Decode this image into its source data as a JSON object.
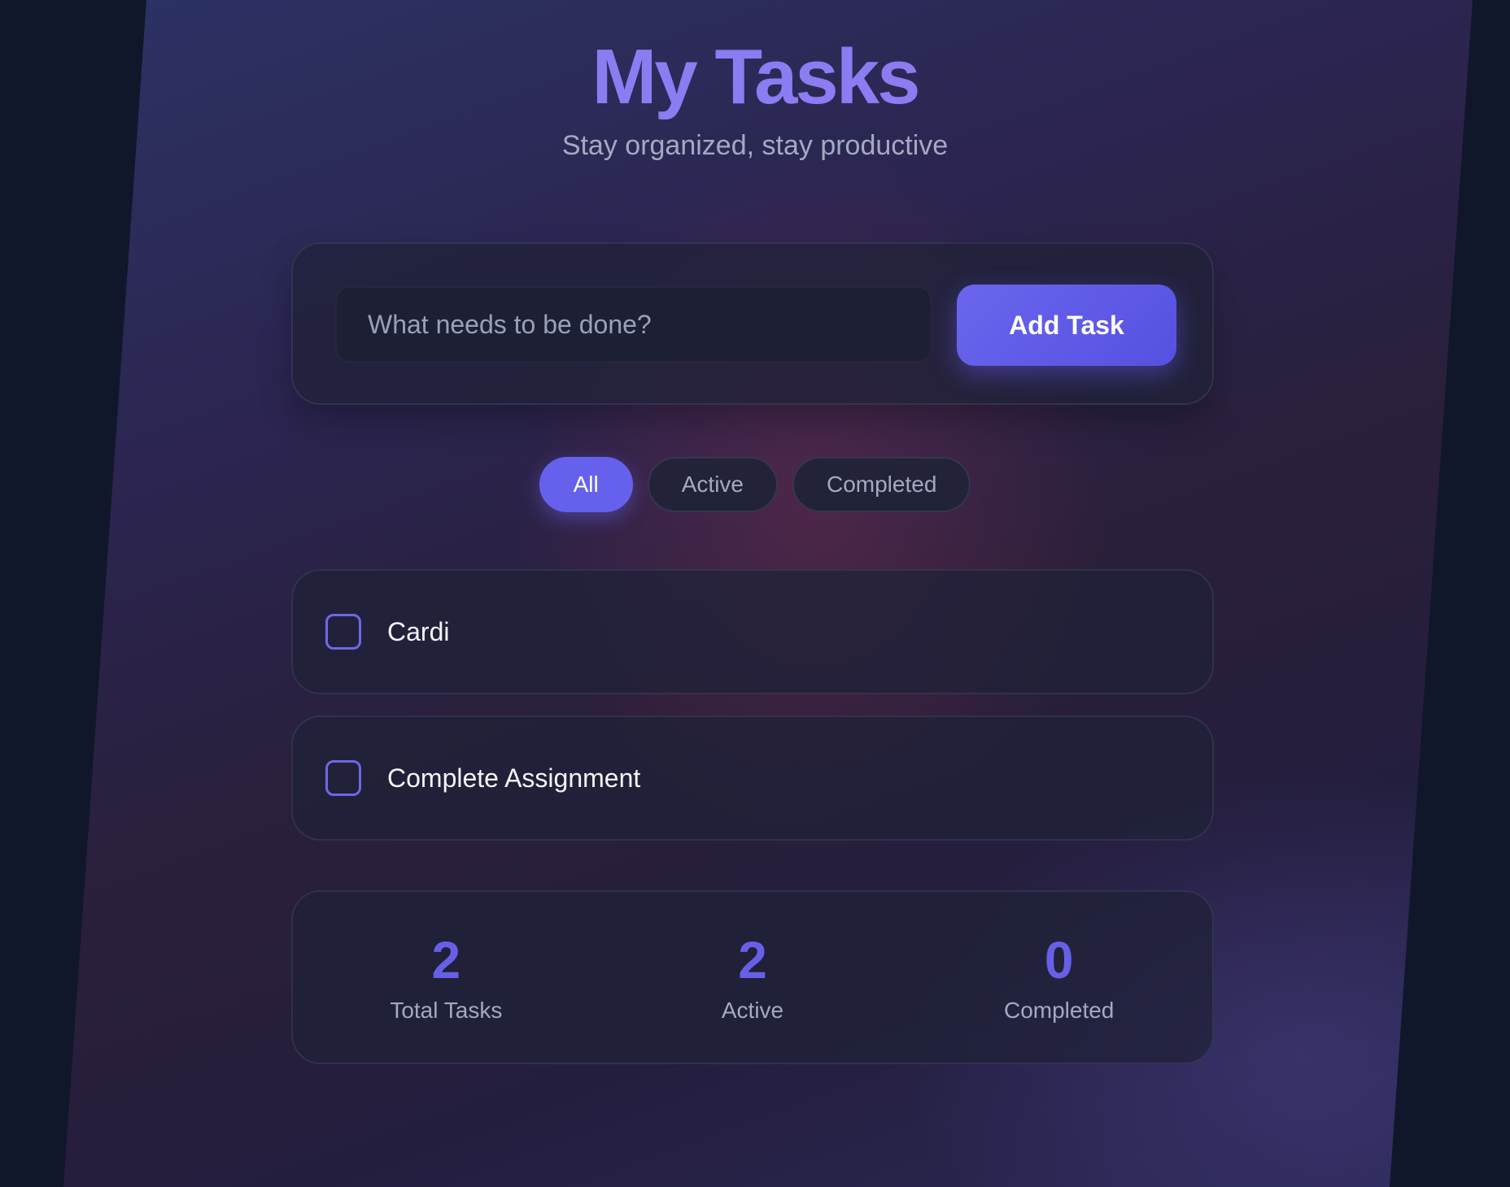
{
  "header": {
    "title": "My Tasks",
    "subtitle": "Stay organized, stay productive"
  },
  "new_task": {
    "placeholder": "What needs to be done?",
    "value": "",
    "add_label": "Add Task"
  },
  "filters": {
    "selected": "All",
    "items": [
      {
        "label": "All"
      },
      {
        "label": "Active"
      },
      {
        "label": "Completed"
      }
    ]
  },
  "tasks": [
    {
      "text": "Cardi",
      "completed": false
    },
    {
      "text": "Complete Assignment",
      "completed": false
    }
  ],
  "stats": [
    {
      "value": "2",
      "label": "Total Tasks"
    },
    {
      "value": "2",
      "label": "Active"
    },
    {
      "value": "0",
      "label": "Completed"
    }
  ],
  "colors": {
    "accent": "#6661ec",
    "title": "#8b7cf2",
    "muted_text": "#a4a9c2",
    "background": "#10172a"
  }
}
